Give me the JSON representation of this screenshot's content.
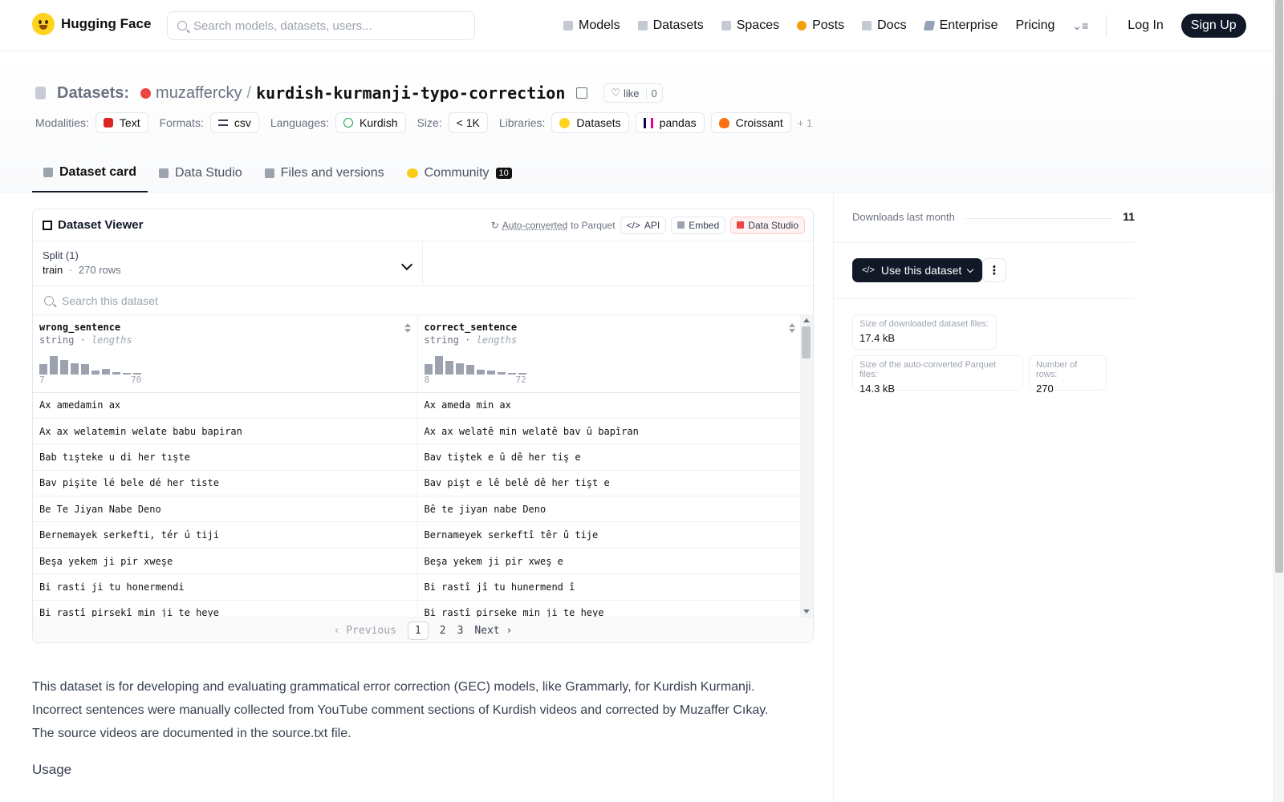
{
  "nav": {
    "brand": "Hugging Face",
    "search_placeholder": "Search models, datasets, users...",
    "links": [
      "Models",
      "Datasets",
      "Spaces",
      "Posts",
      "Docs",
      "Enterprise",
      "Pricing"
    ],
    "login": "Log In",
    "signup": "Sign Up"
  },
  "header": {
    "prefix": "Datasets:",
    "user": "muzaffercky",
    "sep": "/",
    "name": "kurdish-kurmanji-typo-correction",
    "like_label": "like",
    "like_count": "0",
    "tags": {
      "modalities_label": "Modalities:",
      "modality": "Text",
      "formats_label": "Formats:",
      "format": "csv",
      "languages_label": "Languages:",
      "language": "Kurdish",
      "size_label": "Size:",
      "size": "< 1K",
      "libraries_label": "Libraries:",
      "libs": [
        "Datasets",
        "pandas",
        "Croissant"
      ],
      "more": "+ 1"
    },
    "tabs": [
      "Dataset card",
      "Data Studio",
      "Files and versions",
      "Community"
    ],
    "community_count": "10"
  },
  "viewer": {
    "title": "Dataset Viewer",
    "auto_u": "Auto-converted",
    "auto_rest": "to Parquet",
    "api": "API",
    "embed": "Embed",
    "studio": "Data Studio",
    "split_label": "Split (1)",
    "split_name": "train",
    "split_dot": "·",
    "split_rows": "270 rows",
    "search_placeholder": "Search this dataset",
    "columns": [
      {
        "name": "wrong_sentence",
        "type": "string",
        "stat": "lengths",
        "min": "7",
        "max": "70",
        "hist": [
          0.5,
          0.9,
          0.7,
          0.55,
          0.5,
          0.2,
          0.25,
          0.12,
          0.06,
          0.03
        ]
      },
      {
        "name": "correct_sentence",
        "type": "string",
        "stat": "lengths",
        "min": "8",
        "max": "72",
        "hist": [
          0.5,
          0.9,
          0.65,
          0.55,
          0.48,
          0.22,
          0.18,
          0.12,
          0.05,
          0.03
        ]
      }
    ],
    "rows": [
      [
        "Ax amedamin ax",
        "Ax ameda min ax"
      ],
      [
        "Ax ax welatemin welate babu bapiran",
        "Ax ax welatê min welatê bav û bapîran"
      ],
      [
        "Bab tışteke u di her tışte",
        "Bav tiştek e û dê her tiş e"
      ],
      [
        "Bav pişite lé bele dé her tiste",
        "Bav pişt e lê belê dê her tişt e"
      ],
      [
        "Be Te Jiyan Nabe Deno",
        "Bê te jiyan nabe Deno"
      ],
      [
        "Bernemayek serkefti, tér ú tiji",
        "Bernameyek serkeftî têr û tije"
      ],
      [
        "Beşa yekem ji pir xweşe",
        "Beşa yekem ji pir xweş e"
      ],
      [
        "Bi rasti ji tu honermendi",
        "Bi rastî jî tu hunermend î"
      ],
      [
        "Bi rastî pirsekî min ji te heye",
        "Bi rastî pirseke min ji te heye"
      ]
    ],
    "pager": {
      "prev": "Previous",
      "pages": [
        "1",
        "2",
        "3"
      ],
      "next": "Next"
    }
  },
  "sidebar": {
    "downloads_label": "Downloads last month",
    "downloads": "11",
    "use_label": "Use this dataset",
    "stats": [
      {
        "label": "Size of downloaded dataset files:",
        "value": "17.4 kB"
      },
      {
        "label": "Size of the auto-converted Parquet files:",
        "value": "14.3 kB"
      },
      {
        "label": "Number of rows:",
        "value": "270"
      }
    ]
  },
  "card": {
    "lines": [
      "This dataset is for developing and evaluating grammatical error correction (GEC) models, like Grammarly, for Kurdish Kurmanji.",
      "Incorrect sentences were manually collected from YouTube comment sections of Kurdish videos and corrected by Muzaffer Cıkay.",
      "The source videos are documented in the source.txt file."
    ],
    "usage": "Usage"
  }
}
